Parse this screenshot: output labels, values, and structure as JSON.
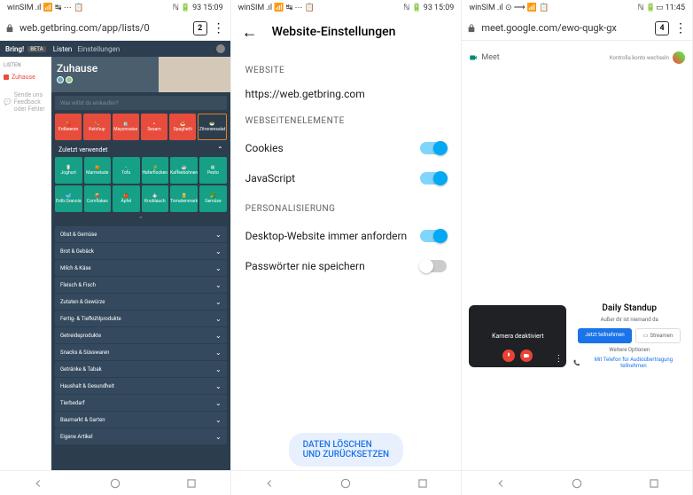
{
  "p1": {
    "status": {
      "carrier": "winSIM",
      "icons": "📶 📡 ⟷ ⋯ 🔋",
      "nfc": "ℕ",
      "battery": "93",
      "time": "15:09"
    },
    "url": "web.getbring.com/app/lists/0",
    "tabs": "2",
    "header": {
      "logo": "Bring!",
      "beta": "BETA",
      "tabs": [
        "Listen",
        "Einstellungen"
      ]
    },
    "sidebar": {
      "heading": "LISTEN",
      "active": "Zuhause",
      "feedback": "Sende uns Feedback oder Fehler"
    },
    "main": {
      "title": "Zuhause",
      "search": "Was willst du einkaufen?",
      "red_tiles": [
        "Erdbeeren",
        "Ketchup",
        "Mayonnaise",
        "Sesam",
        "Spaghetti",
        "Zitronensalat"
      ],
      "recent_label": "Zuletzt verwendet",
      "teal1": [
        "Joghurt",
        "Marmelade",
        "Tofu",
        "Haferflocken",
        "Kaffeebohnen",
        "Pesto"
      ],
      "teal2": [
        "Erdb.Granola",
        "Cornflakes",
        "Äpfel",
        "Knoblauch",
        "Tomatenmark",
        "Gemüse"
      ],
      "categories": [
        "Obst & Gemüse",
        "Brot & Gebäck",
        "Milch & Käse",
        "Fleisch & Fisch",
        "Zutaten & Gewürze",
        "Fertig- & Tiefkühlprodukte",
        "Getreideprodukte",
        "Snacks & Süsswaren",
        "Getränke & Tabak",
        "Haushalt & Gesundheit",
        "Tierbedarf",
        "Baumarkt & Garten",
        "Eigene Artikel"
      ]
    }
  },
  "p2": {
    "status": {
      "carrier": "winSIM",
      "icons": "📶 📡 ⟷ ⋯ 🔋",
      "nfc": "ℕ 🔋",
      "battery": "93",
      "time": "15:09"
    },
    "title": "Website-Einstellungen",
    "sections": {
      "website": {
        "label": "WEBSITE",
        "value": "https://web.getbring.com"
      },
      "elements": {
        "label": "WEBSEITENELEMENTE",
        "cookies": "Cookies",
        "js": "JavaScript"
      },
      "personal": {
        "label": "PERSONALISIERUNG",
        "desktop": "Desktop-Website immer anfordern",
        "password": "Passwörter nie speichern"
      }
    },
    "reset": "DATEN LÖSCHEN UND ZURÜCKSETZEN"
  },
  "p3": {
    "status": {
      "carrier": "winSIM",
      "icons": "📶 ⊙ ⟶ 📡 🔋",
      "nfc": "ℕ 🔋",
      "time": "11:45"
    },
    "url": "meet.google.com/ewo-qugk-gx",
    "tabs": "4",
    "meet": {
      "label": "Meet",
      "account": "Kontrolla\nkonto wechseln"
    },
    "video": {
      "camera_off": "Kamera deaktiviert"
    },
    "meeting": {
      "title": "Daily Standup",
      "sub": "Außer dir ist niemand da",
      "join": "Jetzt teilnehmen",
      "present": "Streamen",
      "more": "Weitere Optionen",
      "phone": "Mit Telefon für Audioübertragung teilnehmen"
    }
  }
}
